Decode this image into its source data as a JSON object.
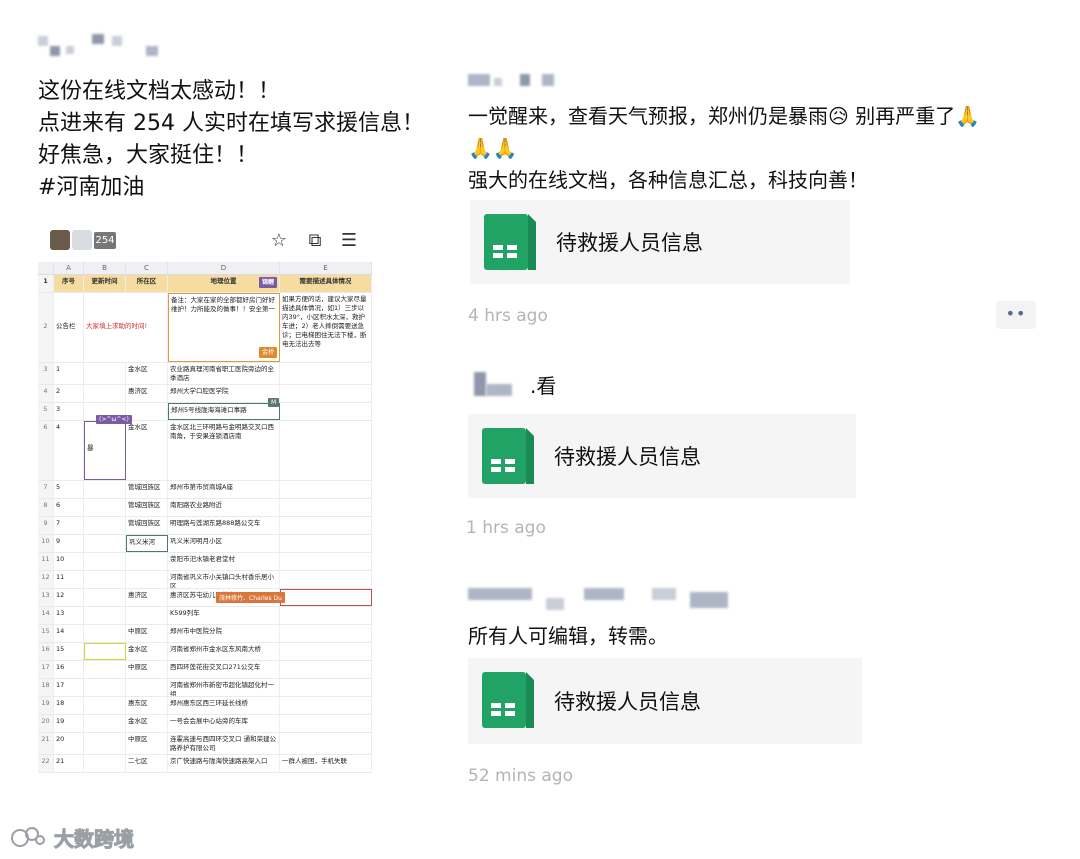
{
  "left_post": {
    "lines": [
      "这份在线文档太感动！！",
      "点进来有 254 人实时在填写求援信息！",
      "好焦急，大家挺住！！",
      "#河南加油"
    ]
  },
  "sheet": {
    "online_count": "254",
    "columns": [
      "A",
      "B",
      "C",
      "D",
      "E"
    ],
    "header": [
      "序号",
      "更新时间",
      "所在区",
      "地理位置",
      "需要描述具体情况"
    ],
    "header_tag": "锦鲤",
    "row2": {
      "a": "公告栏",
      "b": "大家填上求助的时间!",
      "d": "备注：大家在家的全部都好房门好好维护！力所能及的做事！！安全第一",
      "e": "如果方便的话，建议大家尽量描述具体情况，如1）三步以内39°，小区积水太深，救护车进；2）老人摔倒需要送急诊；已电梯困住无法下楼，断电无法出去等",
      "d_tag": "金桥"
    },
    "rows": [
      {
        "n": "3",
        "a": "1",
        "b": "",
        "c": "金水区",
        "d": "农业路真理河南省职工医院旁边的全季酒店"
      },
      {
        "n": "4",
        "a": "2",
        "b": "",
        "c": "惠济区",
        "d": "郑州大学口腔医学院"
      },
      {
        "n": "5",
        "a": "3",
        "b": "",
        "c": "",
        "d": "郑州5号线陇海海滩口事路"
      },
      {
        "n": "6",
        "a": "4",
        "b": "暴",
        "c": "金水区",
        "d": "金水区北三环明路与金明路交叉口西南角，于安果连锁酒店南"
      },
      {
        "n": "7",
        "a": "5",
        "b": "",
        "c": "管城回族区",
        "d": "郑州市第市贸商城A座"
      },
      {
        "n": "8",
        "a": "6",
        "b": "",
        "c": "管城回族区",
        "d": "南阳路农业路附近"
      },
      {
        "n": "9",
        "a": "7",
        "b": "",
        "c": "管城回族区",
        "d": "明理路与莲湖东路888路公交车"
      },
      {
        "n": "10",
        "a": "9",
        "b": "",
        "c": "巩义米河",
        "d": "巩义米河明月小区"
      },
      {
        "n": "11",
        "a": "10",
        "b": "",
        "c": "",
        "d": "荥阳市汜水镇老君堂村"
      },
      {
        "n": "12",
        "a": "11",
        "b": "",
        "c": "",
        "d": "河南省巩义市小关镇口头村香乐居小区"
      },
      {
        "n": "13",
        "a": "12",
        "b": "",
        "c": "惠济区",
        "d": "惠济区苏屯幼儿园停车"
      },
      {
        "n": "14",
        "a": "13",
        "b": "",
        "c": "",
        "d": "K599列车"
      },
      {
        "n": "15",
        "a": "14",
        "b": "",
        "c": "中原区",
        "d": "郑州市中医院分院"
      },
      {
        "n": "16",
        "a": "15",
        "b": "",
        "c": "金水区",
        "d": "河南省郑州市金水区东风南大桥"
      },
      {
        "n": "17",
        "a": "16",
        "b": "",
        "c": "中原区",
        "d": "西四环莲花街交叉口271公交车"
      },
      {
        "n": "18",
        "a": "17",
        "b": "",
        "c": "",
        "d": "河南省郑州市新密市超化镇超化村一组"
      },
      {
        "n": "19",
        "a": "18",
        "b": "",
        "c": "惠东区",
        "d": "郑州惠东区西三环延长线桥"
      },
      {
        "n": "20",
        "a": "19",
        "b": "",
        "c": "金水区",
        "d": "一号会会展中心站旁的车库"
      },
      {
        "n": "21",
        "a": "20",
        "b": "",
        "c": "中原区",
        "d": "连霍高速与西四环交叉口 通和荣建公路养护有限公司"
      },
      {
        "n": "22",
        "a": "21",
        "b": "",
        "c": "二七区",
        "d": "京广快速路与陇海快速路高架入口",
        "e": "一群人被困，手机失联"
      }
    ],
    "cursor_tags": [
      "(>^ω^<)",
      "M",
      "茂林修竹、Charles Du"
    ]
  },
  "posts": [
    {
      "text_lines": [
        "一觉醒来，查看天气预报，郑州仍是暴雨😥 别再严重了🙏",
        "🙏🙏",
        "强大的在线文档，各种信息汇总，科技向善！"
      ],
      "card_title": "待救援人员信息",
      "time": "4 hrs ago"
    },
    {
      "name_suffix": ".看",
      "card_title": "待救援人员信息",
      "time": "1 hrs ago"
    },
    {
      "text_lines": [
        "所有人可编辑，转需。"
      ],
      "card_title": "待救援人员信息",
      "time": "52 mins ago"
    }
  ],
  "more_icon": "more-dots-icon",
  "watermark": "大数跨境",
  "colors": {
    "sheet_green": "#21a366",
    "header_yellow": "#f6dca0",
    "time_gray": "#b4b4b4",
    "link_blue": "#5a6b8c"
  }
}
